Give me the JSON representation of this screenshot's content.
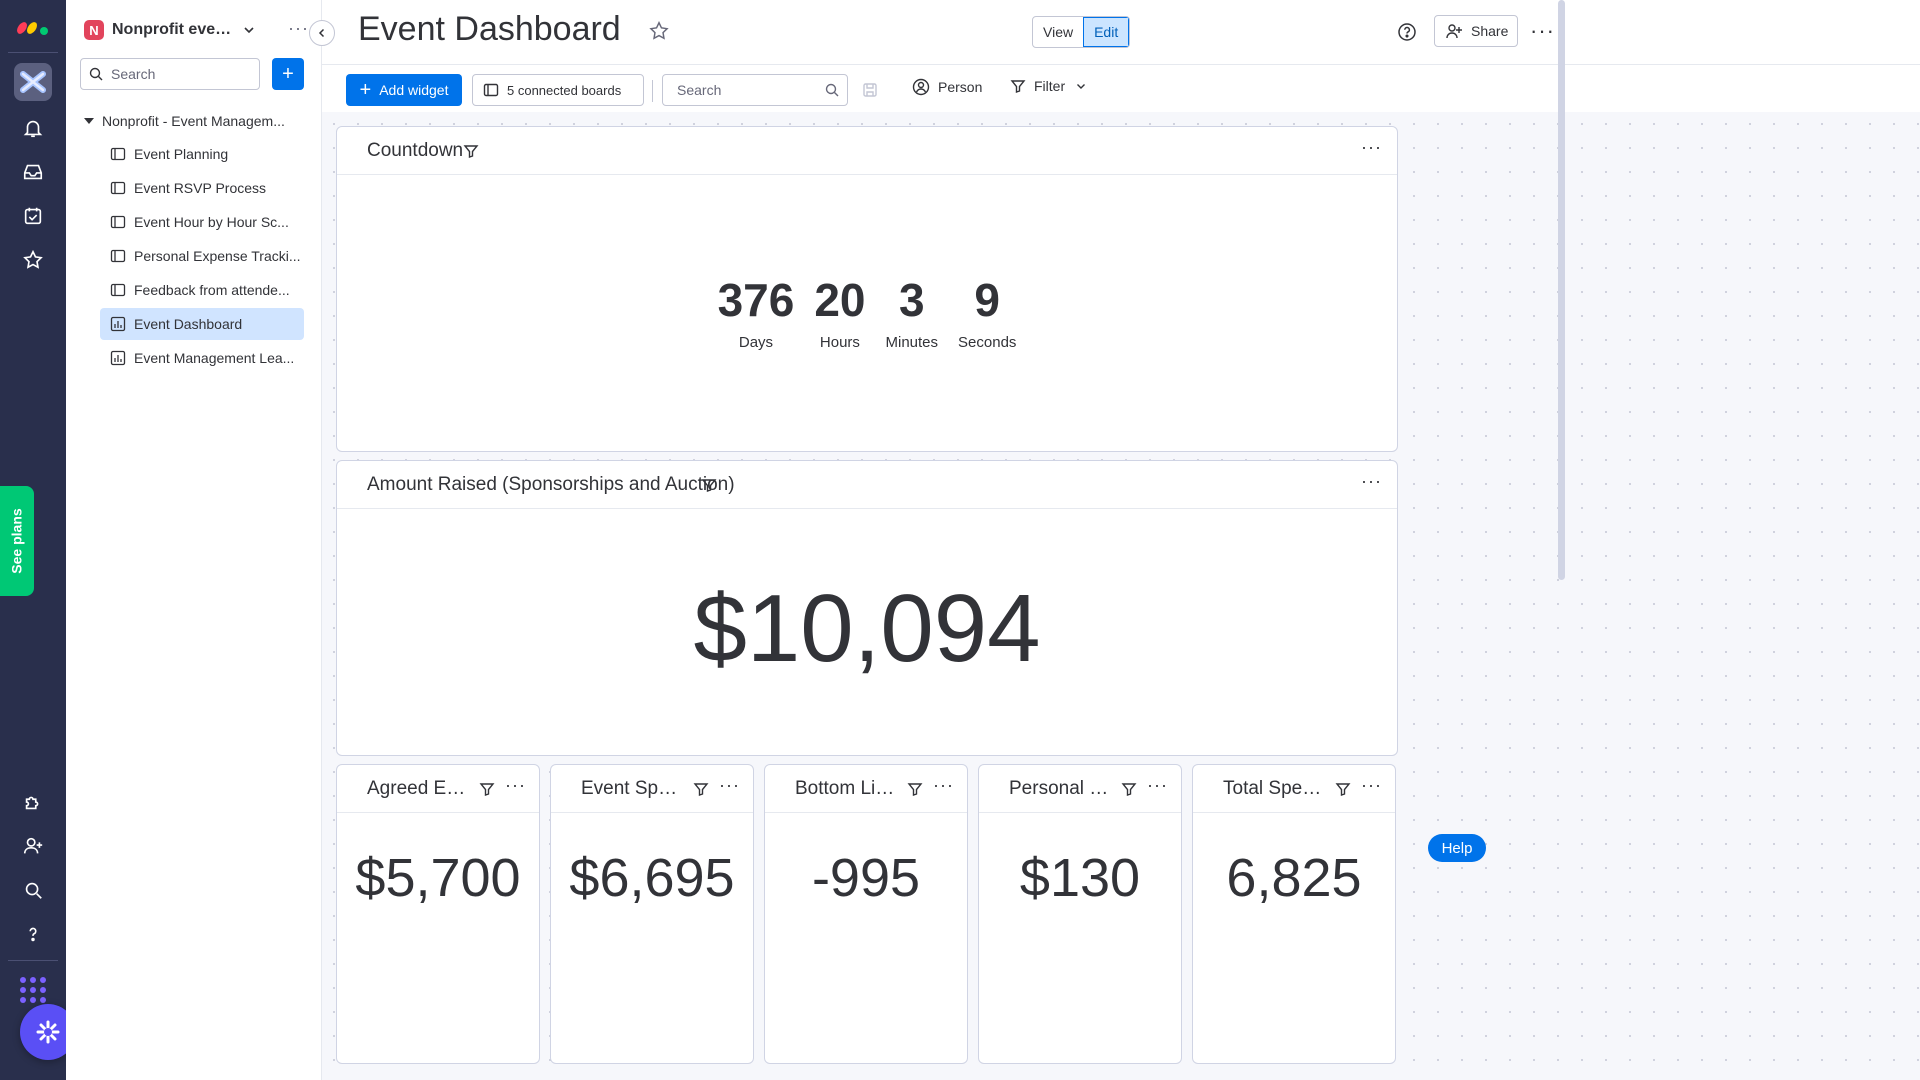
{
  "colors": {
    "rail_bg": "#292f4c",
    "primary": "#0073ea",
    "active_item": "#d0e4ff",
    "see_plans": "#00c875",
    "workspace_badge": "#e2445c",
    "ai_button": "#5a4ff5"
  },
  "rail": {
    "icons": [
      "home-icon",
      "bell-icon",
      "inbox-icon",
      "calendar-icon",
      "star-icon",
      "puzzle-icon",
      "invite-user-icon",
      "search-icon",
      "help-icon",
      "apps-grid-icon"
    ],
    "see_plans": "See plans"
  },
  "sidebar": {
    "workspace_initial": "N",
    "workspace_name": "Nonprofit even...",
    "search_placeholder": "Search",
    "add_label": "+",
    "folder": "Nonprofit - Event Managem...",
    "items": [
      {
        "label": "Event Planning",
        "type": "board"
      },
      {
        "label": "Event RSVP Process",
        "type": "board"
      },
      {
        "label": "Event Hour by Hour Sc...",
        "type": "board"
      },
      {
        "label": "Personal Expense Tracki...",
        "type": "board"
      },
      {
        "label": "Feedback from attende...",
        "type": "board"
      },
      {
        "label": "Event Dashboard",
        "type": "dashboard",
        "active": true
      },
      {
        "label": "Event Management Lea...",
        "type": "dashboard"
      }
    ]
  },
  "header": {
    "title": "Event Dashboard",
    "view_label": "View",
    "edit_label": "Edit",
    "share_label": "Share"
  },
  "toolbar": {
    "add_widget": "Add widget",
    "connected_boards": "5 connected boards",
    "search_placeholder": "Search",
    "person": "Person",
    "filter": "Filter"
  },
  "widgets": {
    "countdown": {
      "title": "Countdown",
      "days": "376",
      "days_label": "Days",
      "hours": "20",
      "hours_label": "Hours",
      "minutes": "3",
      "minutes_label": "Minutes",
      "seconds": "9",
      "seconds_label": "Seconds"
    },
    "amount_raised": {
      "title": "Amount Raised (Sponsorships and Auction)",
      "value": "$10,094"
    },
    "numbers": [
      {
        "title": "Agreed Even...",
        "value": "$5,700"
      },
      {
        "title": "Event Spend...",
        "value": "$6,695"
      },
      {
        "title": "Bottom Line ...",
        "value": "-995"
      },
      {
        "title": "Personal Exp...",
        "value": "$130"
      },
      {
        "title": "Total Spent i...",
        "value": "6,825"
      }
    ]
  },
  "help_button": "Help"
}
